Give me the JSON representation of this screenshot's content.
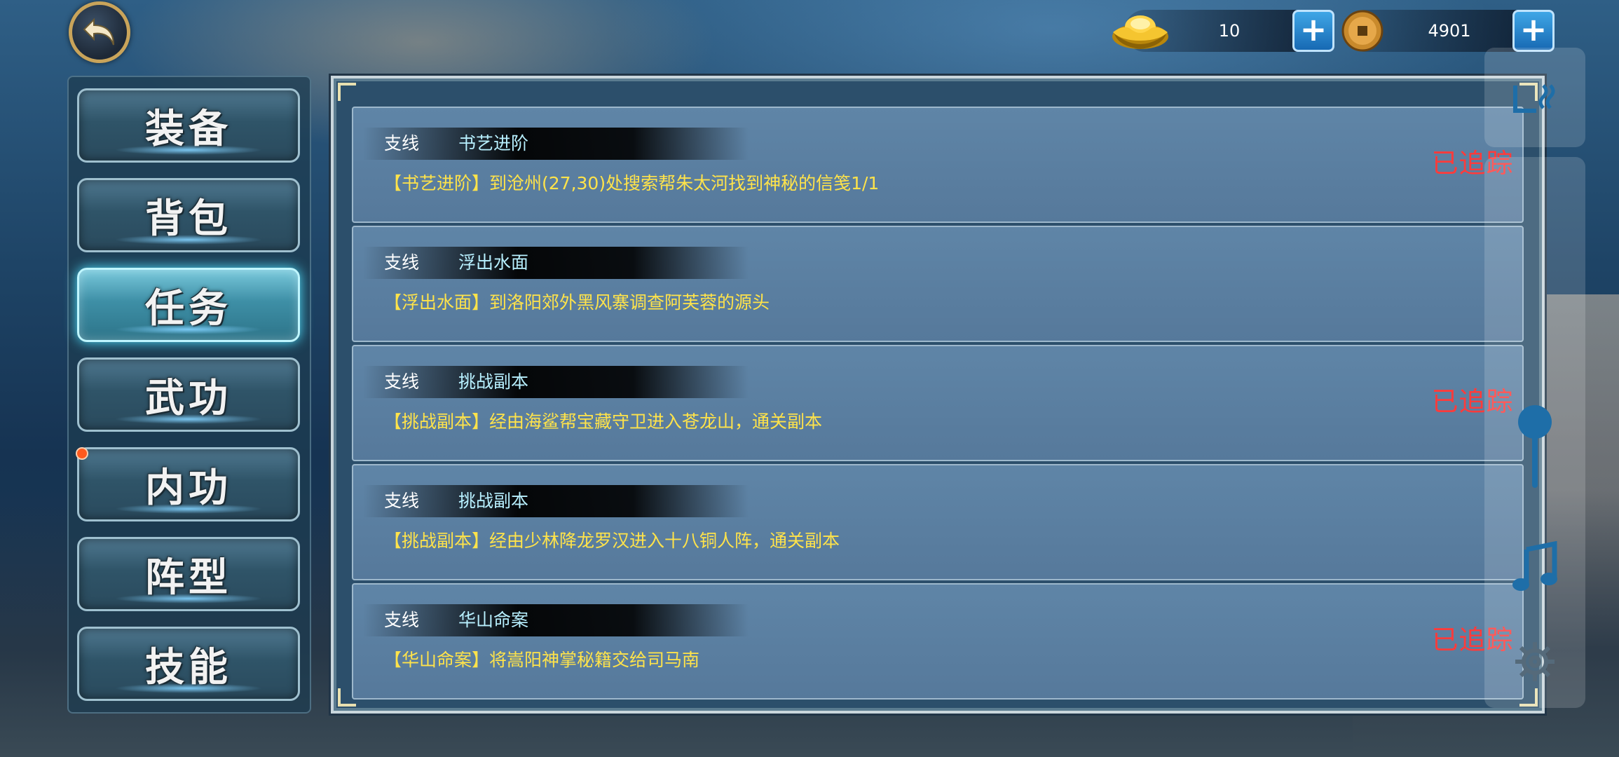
{
  "currency": {
    "gold_ingot": {
      "icon": "gold-ingot-icon",
      "value": "10",
      "plus": "+"
    },
    "coin": {
      "icon": "copper-coin-icon",
      "value": "4901",
      "plus": "+"
    }
  },
  "menu": {
    "items": [
      {
        "label": "装备",
        "active": false
      },
      {
        "label": "背包",
        "active": false
      },
      {
        "label": "任务",
        "active": true
      },
      {
        "label": "武功",
        "active": false
      },
      {
        "label": "内功",
        "active": false
      },
      {
        "label": "阵型",
        "active": false
      },
      {
        "label": "技能",
        "active": false
      }
    ]
  },
  "quests": [
    {
      "type": "支线",
      "name": "书艺进阶",
      "desc": "【书艺进阶】到沧州(27,30)处搜索帮朱太河找到神秘的信笺1/1",
      "status": "已追踪"
    },
    {
      "type": "支线",
      "name": "浮出水面",
      "desc": "【浮出水面】到洛阳郊外黑风寨调查阿芙蓉的源头",
      "status": ""
    },
    {
      "type": "支线",
      "name": "挑战副本",
      "desc": "【挑战副本】经由海鲨帮宝藏守卫进入苍龙山，通关副本",
      "status": "已追踪"
    },
    {
      "type": "支线",
      "name": "挑战副本",
      "desc": "【挑战副本】经由少林降龙罗汉进入十八铜人阵，通关副本",
      "status": ""
    },
    {
      "type": "支线",
      "name": "华山命案",
      "desc": "【华山命案】将嵩阳神掌秘籍交给司马南",
      "status": "已追踪"
    }
  ],
  "side_tools": [
    "wave-icon",
    "slider-knob-icon",
    "music-note-icon",
    "gear-icon"
  ]
}
